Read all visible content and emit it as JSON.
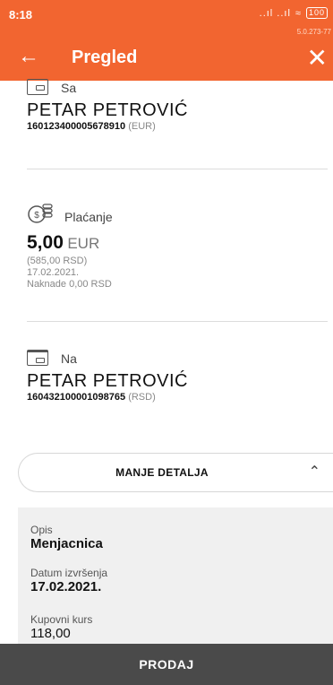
{
  "statusbar": {
    "time": "8:18",
    "signal": "..ıl ..ıl",
    "battery": "100",
    "version": "5.0.273-77"
  },
  "appbar": {
    "title": "Pregled"
  },
  "from": {
    "label": "Sa",
    "name": "PETAR PETROVIĆ",
    "account": "160123400005678910",
    "currency": "(EUR)"
  },
  "payment": {
    "label": "Plaćanje",
    "amount": "5,00",
    "currency": "EUR",
    "rsd": "(585,00 RSD)",
    "date": "17.02.2021.",
    "fee": "Naknade 0,00 RSD"
  },
  "to": {
    "label": "Na",
    "name": "PETAR PETROVIĆ",
    "account": "160432100001098765",
    "currency": "(RSD)"
  },
  "details_toggle": {
    "label": "MANJE DETALJA"
  },
  "details": [
    {
      "label": "Opis",
      "value": "Menjacnica"
    },
    {
      "label": "Datum izvršenja",
      "value": "17.02.2021."
    },
    {
      "label": "Kupovni kurs",
      "value": "118,00"
    }
  ],
  "action": {
    "label": "PRODAJ"
  },
  "colors": {
    "accent": "#f26530",
    "bottom_bar": "#4a4a4a"
  }
}
